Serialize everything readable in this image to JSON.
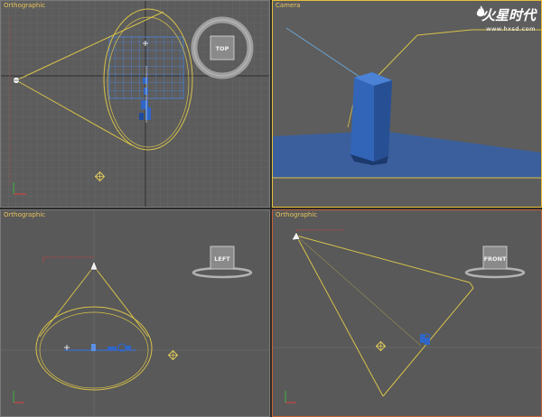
{
  "viewports": {
    "top": {
      "label": "Orthographic",
      "nav_cube_label": "TOP"
    },
    "camera": {
      "label": "Camera"
    },
    "left": {
      "label": "Orthographic",
      "nav_cube_label": "LEFT"
    },
    "front": {
      "label": "Orthographic",
      "nav_cube_label": "FRONT"
    }
  },
  "watermark": {
    "logo_text": "火星时代",
    "url": "www.hxsd.com"
  },
  "colors": {
    "viewport_bg": "#5a5a5a",
    "grid_line": "#6e6e6e",
    "light_cone": "#d8c24a",
    "object_blue": "#2f5fb0",
    "active_border": "#e6c03a",
    "label_text": "#e8c45a"
  }
}
